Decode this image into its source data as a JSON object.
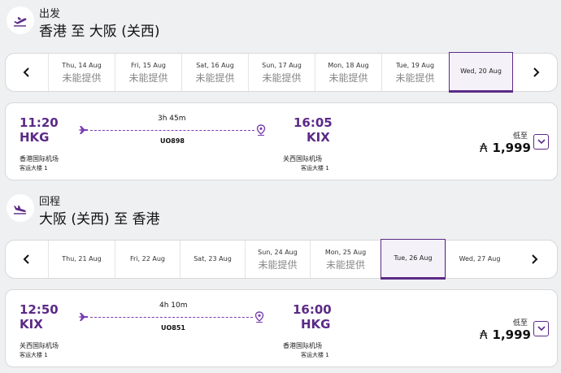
{
  "colors": {
    "accent": "#5b2a86",
    "line": "#7a3fb0"
  },
  "outbound": {
    "label": "出发",
    "route": "香港 至 大阪 (关西)",
    "icon": "plane-takeoff-icon",
    "dates": [
      {
        "date": "Thu, 14 Aug",
        "status": "未能提供"
      },
      {
        "date": "Fri, 15 Aug",
        "status": "未能提供"
      },
      {
        "date": "Sat, 16 Aug",
        "status": "未能提供"
      },
      {
        "date": "Sun, 17 Aug",
        "status": "未能提供"
      },
      {
        "date": "Mon, 18 Aug",
        "status": "未能提供"
      },
      {
        "date": "Tue, 19 Aug",
        "status": "未能提供"
      },
      {
        "date": "Wed, 20 Aug",
        "status": ""
      }
    ],
    "selected_index": 6,
    "flight": {
      "dep_time": "11:20",
      "dep_code": "HKG",
      "dep_airport": "香港国际机场",
      "dep_terminal": "客运大楼 1",
      "arr_time": "16:05",
      "arr_code": "KIX",
      "arr_airport": "关西国际机场",
      "arr_terminal": "客运大楼 1",
      "duration": "3h 45m",
      "flight_no": "UO898",
      "low_label": "低至",
      "currency": "₳",
      "price": "1,999"
    }
  },
  "inbound": {
    "label": "回程",
    "route": "大阪 (关西) 至 香港",
    "icon": "plane-landing-icon",
    "dates": [
      {
        "date": "Thu, 21 Aug",
        "status": ""
      },
      {
        "date": "Fri, 22 Aug",
        "status": ""
      },
      {
        "date": "Sat, 23 Aug",
        "status": ""
      },
      {
        "date": "Sun, 24 Aug",
        "status": "未能提供"
      },
      {
        "date": "Mon, 25 Aug",
        "status": "未能提供"
      },
      {
        "date": "Tue, 26 Aug",
        "status": ""
      },
      {
        "date": "Wed, 27 Aug",
        "status": ""
      }
    ],
    "selected_index": 5,
    "flight": {
      "dep_time": "12:50",
      "dep_code": "KIX",
      "dep_airport": "关西国际机场",
      "dep_terminal": "客运大楼 1",
      "arr_time": "16:00",
      "arr_code": "HKG",
      "arr_airport": "香港国际机场",
      "arr_terminal": "客运大楼 1",
      "duration": "4h 10m",
      "flight_no": "UO851",
      "low_label": "低至",
      "currency": "₳",
      "price": "1,999"
    }
  }
}
